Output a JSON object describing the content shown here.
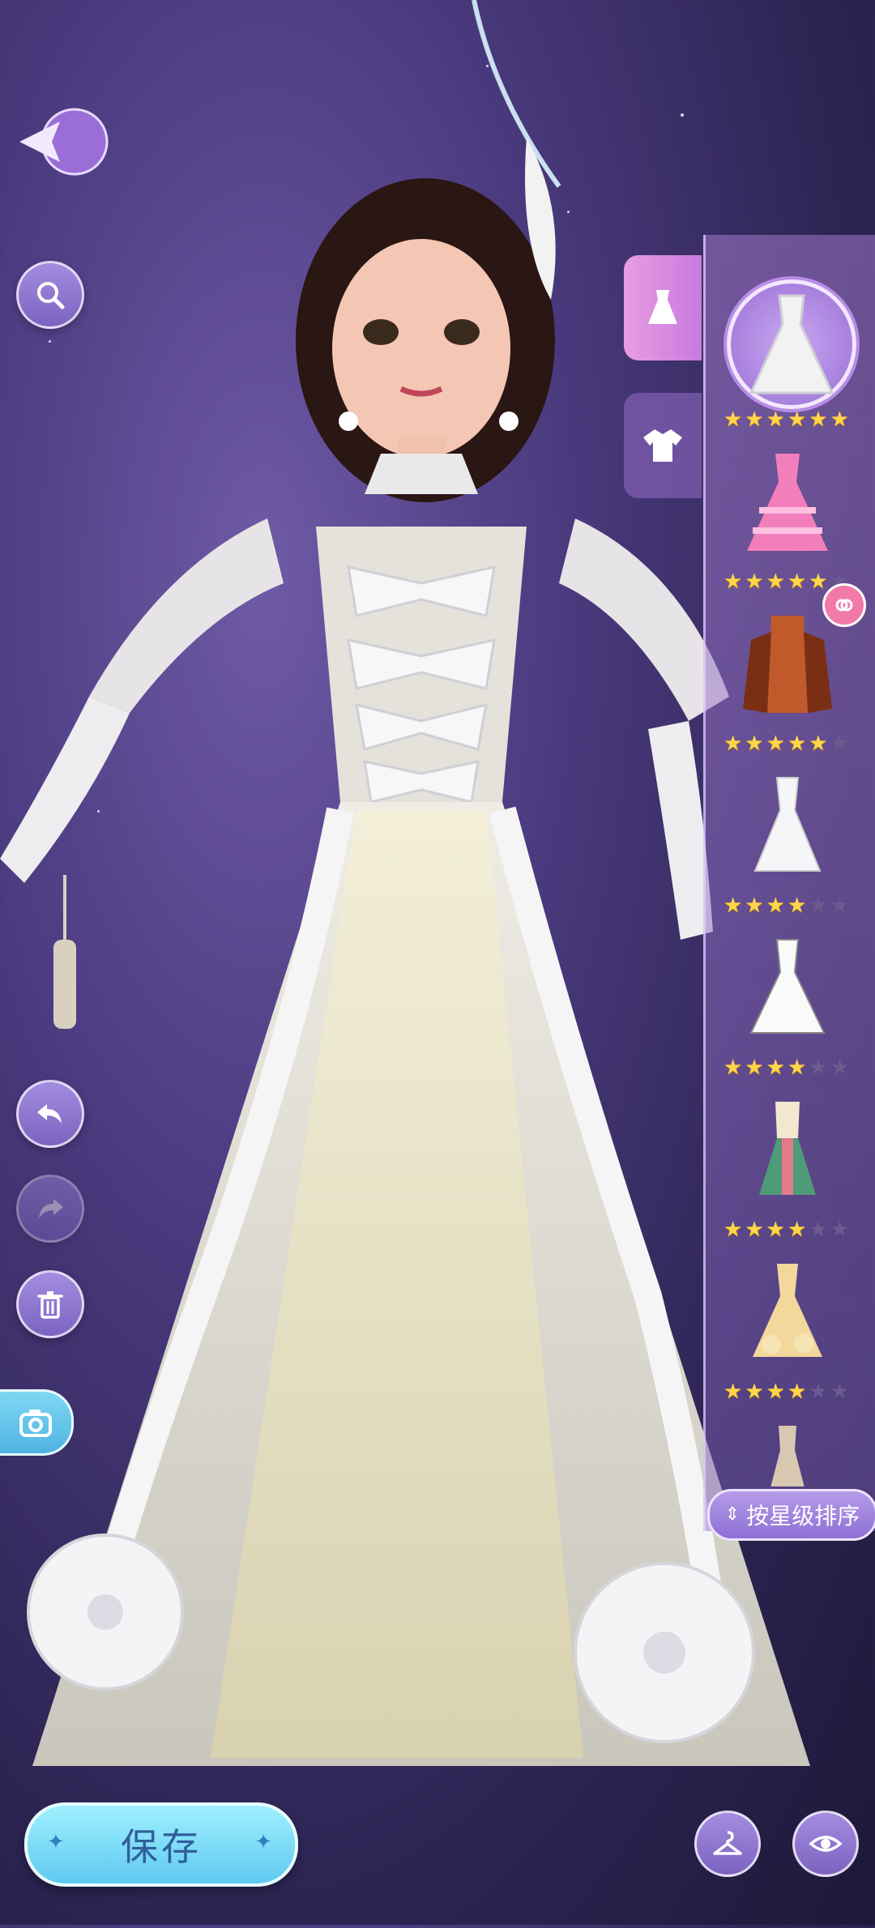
{
  "toolbar": {
    "back_icon": "back-arrow-icon",
    "search_icon": "search-icon",
    "undo_icon": "undo-icon",
    "redo_icon": "redo-icon",
    "delete_icon": "trash-icon",
    "camera_icon": "camera-icon"
  },
  "categories": [
    {
      "icon": "dress-icon",
      "active": true
    },
    {
      "icon": "top-icon",
      "active": false
    }
  ],
  "items": [
    {
      "name": "white-ball-gown",
      "stars": 6,
      "max_stars": 6,
      "selected": true
    },
    {
      "name": "pink-tiered-gown",
      "stars": 5,
      "max_stars": 6
    },
    {
      "name": "copper-robe",
      "stars": 5,
      "max_stars": 6,
      "badge": "tag-icon"
    },
    {
      "name": "white-lace-dress",
      "stars": 4,
      "max_stars": 6
    },
    {
      "name": "white-gown",
      "stars": 4,
      "max_stars": 6
    },
    {
      "name": "folk-dress",
      "stars": 4,
      "max_stars": 6
    },
    {
      "name": "gold-rose-gown",
      "stars": 4,
      "max_stars": 6
    },
    {
      "name": "beige-dress",
      "stars": 0,
      "max_stars": 0
    }
  ],
  "sort": {
    "label": "按星级排序"
  },
  "save": {
    "label": "保存"
  },
  "bottom_right": {
    "wardrobe_icon": "hanger-icon",
    "view_icon": "eye-icon"
  },
  "colors": {
    "accent": "#8e6fd4",
    "save": "#5fc9f0",
    "star": "#ffd54a"
  }
}
